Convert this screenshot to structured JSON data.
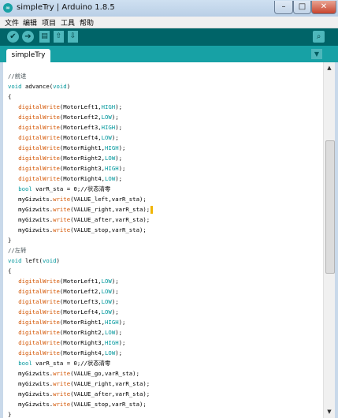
{
  "window": {
    "title": "simpleTry | Arduino 1.8.5",
    "app_icon_glyph": "∞",
    "minimize_glyph": "–",
    "maximize_glyph": "□",
    "close_glyph": "✕"
  },
  "menu": {
    "items": [
      "文件",
      "编辑",
      "项目",
      "工具",
      "帮助"
    ]
  },
  "toolbar": {
    "verify_icon": "check-icon",
    "verify_glyph": "✔",
    "upload_icon": "arrow-right-icon",
    "upload_glyph": "➔",
    "new_icon": "new-file-icon",
    "new_glyph": "▤",
    "open_icon": "arrow-up-icon",
    "open_glyph": "⇧",
    "save_icon": "arrow-down-icon",
    "save_glyph": "⇩",
    "serial_icon": "magnifier-icon",
    "serial_glyph": "⌕"
  },
  "tabs": {
    "active_label": "simpleTry",
    "menu_glyph": "▼"
  },
  "scrollbar": {
    "up_glyph": "▲",
    "down_glyph": "▼"
  },
  "colors": {
    "toolbar": "#006468",
    "tabbar": "#17a1a5",
    "keyword": "#00979c",
    "function": "#d35400",
    "comment": "#434f54"
  },
  "code": [
    [
      {
        "t": "//前进",
        "c": "comment"
      }
    ],
    [
      {
        "t": "void",
        "c": "kw"
      },
      {
        "t": " advance(",
        "c": "plain"
      },
      {
        "t": "void",
        "c": "kw"
      },
      {
        "t": ")",
        "c": "plain"
      }
    ],
    [
      {
        "t": "{",
        "c": "plain"
      }
    ],
    [
      {
        "t": "   ",
        "c": "plain"
      },
      {
        "t": "digitalWrite",
        "c": "fn"
      },
      {
        "t": "(MotorLeft1,",
        "c": "plain"
      },
      {
        "t": "HIGH",
        "c": "kw"
      },
      {
        "t": ");",
        "c": "plain"
      }
    ],
    [
      {
        "t": "   ",
        "c": "plain"
      },
      {
        "t": "digitalWrite",
        "c": "fn"
      },
      {
        "t": "(MotorLeft2,",
        "c": "plain"
      },
      {
        "t": "LOW",
        "c": "kw"
      },
      {
        "t": ");",
        "c": "plain"
      }
    ],
    [
      {
        "t": "   ",
        "c": "plain"
      },
      {
        "t": "digitalWrite",
        "c": "fn"
      },
      {
        "t": "(MotorLeft3,",
        "c": "plain"
      },
      {
        "t": "HIGH",
        "c": "kw"
      },
      {
        "t": ");",
        "c": "plain"
      }
    ],
    [
      {
        "t": "   ",
        "c": "plain"
      },
      {
        "t": "digitalWrite",
        "c": "fn"
      },
      {
        "t": "(MotorLeft4,",
        "c": "plain"
      },
      {
        "t": "LOW",
        "c": "kw"
      },
      {
        "t": ");",
        "c": "plain"
      }
    ],
    [
      {
        "t": "   ",
        "c": "plain"
      },
      {
        "t": "digitalWrite",
        "c": "fn"
      },
      {
        "t": "(MotorRight1,",
        "c": "plain"
      },
      {
        "t": "HIGH",
        "c": "kw"
      },
      {
        "t": ");",
        "c": "plain"
      }
    ],
    [
      {
        "t": "   ",
        "c": "plain"
      },
      {
        "t": "digitalWrite",
        "c": "fn"
      },
      {
        "t": "(MotorRight2,",
        "c": "plain"
      },
      {
        "t": "LOW",
        "c": "kw"
      },
      {
        "t": ");",
        "c": "plain"
      }
    ],
    [
      {
        "t": "   ",
        "c": "plain"
      },
      {
        "t": "digitalWrite",
        "c": "fn"
      },
      {
        "t": "(MotorRight3,",
        "c": "plain"
      },
      {
        "t": "HIGH",
        "c": "kw"
      },
      {
        "t": ");",
        "c": "plain"
      }
    ],
    [
      {
        "t": "   ",
        "c": "plain"
      },
      {
        "t": "digitalWrite",
        "c": "fn"
      },
      {
        "t": "(MotorRight4,",
        "c": "plain"
      },
      {
        "t": "LOW",
        "c": "kw"
      },
      {
        "t": ");",
        "c": "plain"
      }
    ],
    [
      {
        "t": "   ",
        "c": "plain"
      },
      {
        "t": "bool",
        "c": "kw"
      },
      {
        "t": " varR_sta = 0;//状态清零",
        "c": "plain"
      }
    ],
    [
      {
        "t": "   myGizwits.",
        "c": "plain"
      },
      {
        "t": "write",
        "c": "fn"
      },
      {
        "t": "(VALUE_left,varR_sta);",
        "c": "plain"
      }
    ],
    [
      {
        "t": "   myGizwits.",
        "c": "plain"
      },
      {
        "t": "write",
        "c": "fn"
      },
      {
        "t": "(VALUE_right,varR_sta);",
        "c": "plain"
      },
      {
        "t": "",
        "c": "cursor"
      }
    ],
    [
      {
        "t": "   myGizwits.",
        "c": "plain"
      },
      {
        "t": "write",
        "c": "fn"
      },
      {
        "t": "(VALUE_after,varR_sta);",
        "c": "plain"
      }
    ],
    [
      {
        "t": "   myGizwits.",
        "c": "plain"
      },
      {
        "t": "write",
        "c": "fn"
      },
      {
        "t": "(VALUE_stop,varR_sta);",
        "c": "plain"
      }
    ],
    [
      {
        "t": "}",
        "c": "plain"
      }
    ],
    [
      {
        "t": "//左转",
        "c": "comment"
      }
    ],
    [
      {
        "t": "void",
        "c": "kw"
      },
      {
        "t": " left(",
        "c": "plain"
      },
      {
        "t": "void",
        "c": "kw"
      },
      {
        "t": ")",
        "c": "plain"
      }
    ],
    [
      {
        "t": "{",
        "c": "plain"
      }
    ],
    [
      {
        "t": "   ",
        "c": "plain"
      },
      {
        "t": "digitalWrite",
        "c": "fn"
      },
      {
        "t": "(MotorLeft1,",
        "c": "plain"
      },
      {
        "t": "LOW",
        "c": "kw"
      },
      {
        "t": ");",
        "c": "plain"
      }
    ],
    [
      {
        "t": "   ",
        "c": "plain"
      },
      {
        "t": "digitalWrite",
        "c": "fn"
      },
      {
        "t": "(MotorLeft2,",
        "c": "plain"
      },
      {
        "t": "LOW",
        "c": "kw"
      },
      {
        "t": ");",
        "c": "plain"
      }
    ],
    [
      {
        "t": "   ",
        "c": "plain"
      },
      {
        "t": "digitalWrite",
        "c": "fn"
      },
      {
        "t": "(MotorLeft3,",
        "c": "plain"
      },
      {
        "t": "LOW",
        "c": "kw"
      },
      {
        "t": ");",
        "c": "plain"
      }
    ],
    [
      {
        "t": "   ",
        "c": "plain"
      },
      {
        "t": "digitalWrite",
        "c": "fn"
      },
      {
        "t": "(MotorLeft4,",
        "c": "plain"
      },
      {
        "t": "LOW",
        "c": "kw"
      },
      {
        "t": ");",
        "c": "plain"
      }
    ],
    [
      {
        "t": "   ",
        "c": "plain"
      },
      {
        "t": "digitalWrite",
        "c": "fn"
      },
      {
        "t": "(MotorRight1,",
        "c": "plain"
      },
      {
        "t": "HIGH",
        "c": "kw"
      },
      {
        "t": ");",
        "c": "plain"
      }
    ],
    [
      {
        "t": "   ",
        "c": "plain"
      },
      {
        "t": "digitalWrite",
        "c": "fn"
      },
      {
        "t": "(MotorRight2,",
        "c": "plain"
      },
      {
        "t": "LOW",
        "c": "kw"
      },
      {
        "t": ");",
        "c": "plain"
      }
    ],
    [
      {
        "t": "   ",
        "c": "plain"
      },
      {
        "t": "digitalWrite",
        "c": "fn"
      },
      {
        "t": "(MotorRight3,",
        "c": "plain"
      },
      {
        "t": "HIGH",
        "c": "kw"
      },
      {
        "t": ");",
        "c": "plain"
      }
    ],
    [
      {
        "t": "   ",
        "c": "plain"
      },
      {
        "t": "digitalWrite",
        "c": "fn"
      },
      {
        "t": "(MotorRight4,",
        "c": "plain"
      },
      {
        "t": "LOW",
        "c": "kw"
      },
      {
        "t": ");",
        "c": "plain"
      }
    ],
    [
      {
        "t": "   ",
        "c": "plain"
      },
      {
        "t": "bool",
        "c": "kw"
      },
      {
        "t": " varR_sta = 0;//状态清零",
        "c": "plain"
      }
    ],
    [
      {
        "t": "   myGizwits.",
        "c": "plain"
      },
      {
        "t": "write",
        "c": "fn"
      },
      {
        "t": "(VALUE_go,varR_sta);",
        "c": "plain"
      }
    ],
    [
      {
        "t": "   myGizwits.",
        "c": "plain"
      },
      {
        "t": "write",
        "c": "fn"
      },
      {
        "t": "(VALUE_right,varR_sta);",
        "c": "plain"
      }
    ],
    [
      {
        "t": "   myGizwits.",
        "c": "plain"
      },
      {
        "t": "write",
        "c": "fn"
      },
      {
        "t": "(VALUE_after,varR_sta);",
        "c": "plain"
      }
    ],
    [
      {
        "t": "   myGizwits.",
        "c": "plain"
      },
      {
        "t": "write",
        "c": "fn"
      },
      {
        "t": "(VALUE_stop,varR_sta);",
        "c": "plain"
      }
    ],
    [
      {
        "t": "}",
        "c": "plain"
      }
    ]
  ]
}
